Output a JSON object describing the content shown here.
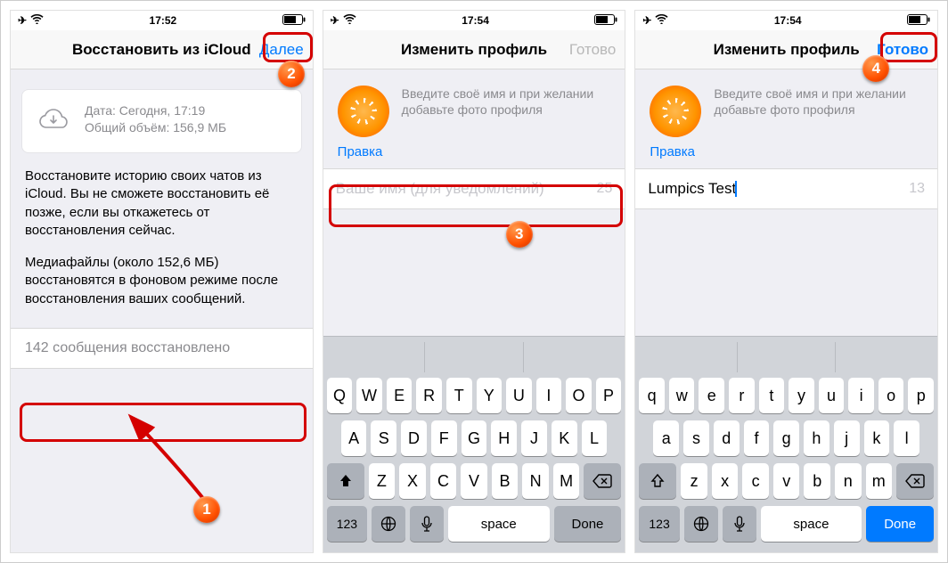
{
  "screen1": {
    "time": "17:52",
    "title": "Восстановить из iCloud",
    "next": "Далее",
    "backup_date": "Дата: Сегодня, 17:19",
    "backup_size": "Общий объём: 156,9 МБ",
    "para1": "Восстановите историю своих чатов из iCloud. Вы не сможете восстановить её позже, если вы откажетесь от восстановления сейчас.",
    "para2": "Медиафайлы (около 152,6 МБ) восстановятся в фоновом режиме после восстановления ваших сообщений.",
    "restored": "142 сообщения восстановлено"
  },
  "screen2": {
    "time": "17:54",
    "title": "Изменить профиль",
    "done": "Готово",
    "hint": "Введите своё имя и при желании добавьте фото профиля",
    "edit": "Правка",
    "placeholder": "Ваше имя (для уведомлений)",
    "count": "25",
    "key_space": "space",
    "key_done": "Done"
  },
  "screen3": {
    "time": "17:54",
    "title": "Изменить профиль",
    "done": "Готово",
    "hint": "Введите своё имя и при желании добавьте фото профиля",
    "edit": "Правка",
    "value": "Lumpics Test",
    "count": "13",
    "key_space": "space",
    "key_done": "Done"
  },
  "keys_upper": {
    "r1": [
      "Q",
      "W",
      "E",
      "R",
      "T",
      "Y",
      "U",
      "I",
      "O",
      "P"
    ],
    "r2": [
      "A",
      "S",
      "D",
      "F",
      "G",
      "H",
      "J",
      "K",
      "L"
    ],
    "r3": [
      "Z",
      "X",
      "C",
      "V",
      "B",
      "N",
      "M"
    ]
  },
  "keys_lower": {
    "r1": [
      "q",
      "w",
      "e",
      "r",
      "t",
      "y",
      "u",
      "i",
      "o",
      "p"
    ],
    "r2": [
      "a",
      "s",
      "d",
      "f",
      "g",
      "h",
      "j",
      "k",
      "l"
    ],
    "r3": [
      "z",
      "x",
      "c",
      "v",
      "b",
      "n",
      "m"
    ]
  },
  "key_123": "123",
  "badges": {
    "b1": "1",
    "b2": "2",
    "b3": "3",
    "b4": "4"
  }
}
